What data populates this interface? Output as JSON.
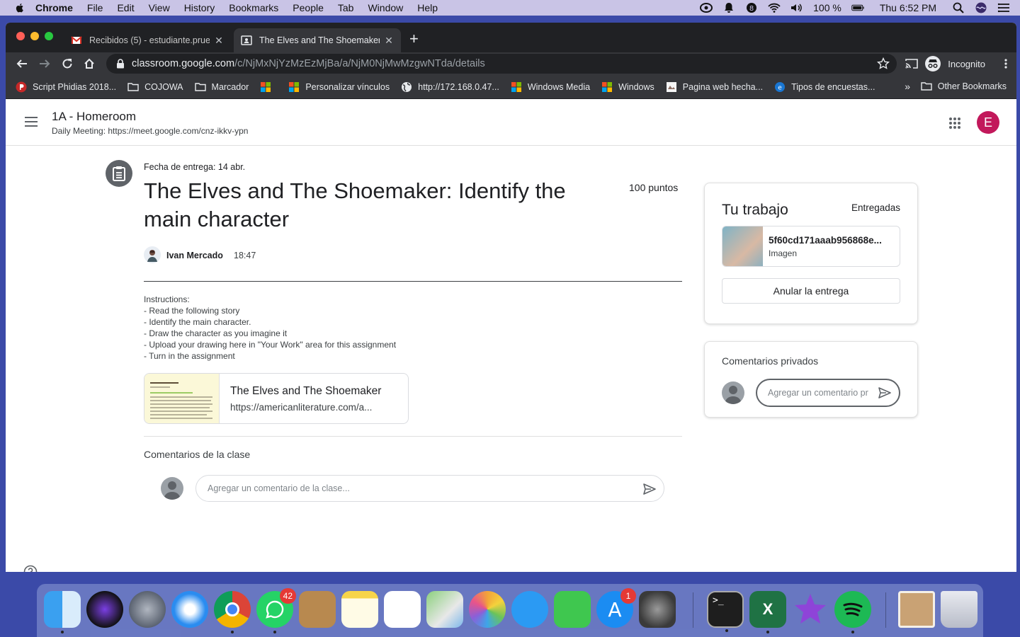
{
  "menubar": {
    "app_name": "Chrome",
    "menus": [
      "File",
      "Edit",
      "View",
      "History",
      "Bookmarks",
      "People",
      "Tab",
      "Window",
      "Help"
    ],
    "battery": "100 %",
    "clock": "Thu 6:52 PM"
  },
  "browser": {
    "tabs": [
      {
        "title": "Recibidos (5) - estudiante.prueba",
        "active": false
      },
      {
        "title": "The Elves and The Shoemaker: Ide",
        "active": true
      }
    ],
    "url_host": "classroom.google.com",
    "url_path": "/c/NjMxNjYzMzEzMjBa/a/NjM0NjMwMzgwNTda/details",
    "profile_label": "Incognito",
    "bookmarks": [
      "Script Phidias 2018...",
      "COJOWA",
      "Marcador",
      "",
      "Personalizar vínculos",
      "http://172.168.0.47...",
      "Windows Media",
      "Windows",
      "Pagina web hecha...",
      "Tipos de encuestas..."
    ],
    "other_bookmarks": "Other Bookmarks"
  },
  "classroom": {
    "class_title": "1A - Homeroom",
    "class_subtitle": "Daily Meeting: https://meet.google.com/cnz-ikkv-ypn",
    "user_initial": "E",
    "assignment": {
      "due": "Fecha de entrega: 14 abr.",
      "title": "The Elves and The Shoemaker: Identify the main character",
      "points": "100 puntos",
      "author": "Ivan Mercado",
      "time": "18:47",
      "instructions": [
        "Instructions:",
        "- Read the following story",
        "- Identify the main character.",
        "- Draw the character as you imagine it",
        "- Upload your drawing here in \"Your Work\" area for this assignment",
        "- Turn in the assignment"
      ],
      "attachment": {
        "title": "The Elves and The Shoemaker",
        "url": "https://americanliterature.com/a..."
      }
    },
    "class_comments": {
      "heading": "Comentarios de la clase",
      "placeholder": "Agregar un comentario de la clase..."
    },
    "your_work": {
      "title": "Tu trabajo",
      "status": "Entregadas",
      "file_name": "5f60cd171aaab956868e...",
      "file_type": "Imagen",
      "unsubmit_label": "Anular la entrega"
    },
    "private_comments": {
      "heading": "Comentarios privados",
      "placeholder": "Agregar un comentario pr"
    }
  },
  "dock": {
    "whatsapp_badge": "42",
    "appstore_badge": "1"
  },
  "colors": {
    "accent_avatar": "#c2185b",
    "chrome_dark": "#202124",
    "chrome_toolbar": "#35363a"
  }
}
